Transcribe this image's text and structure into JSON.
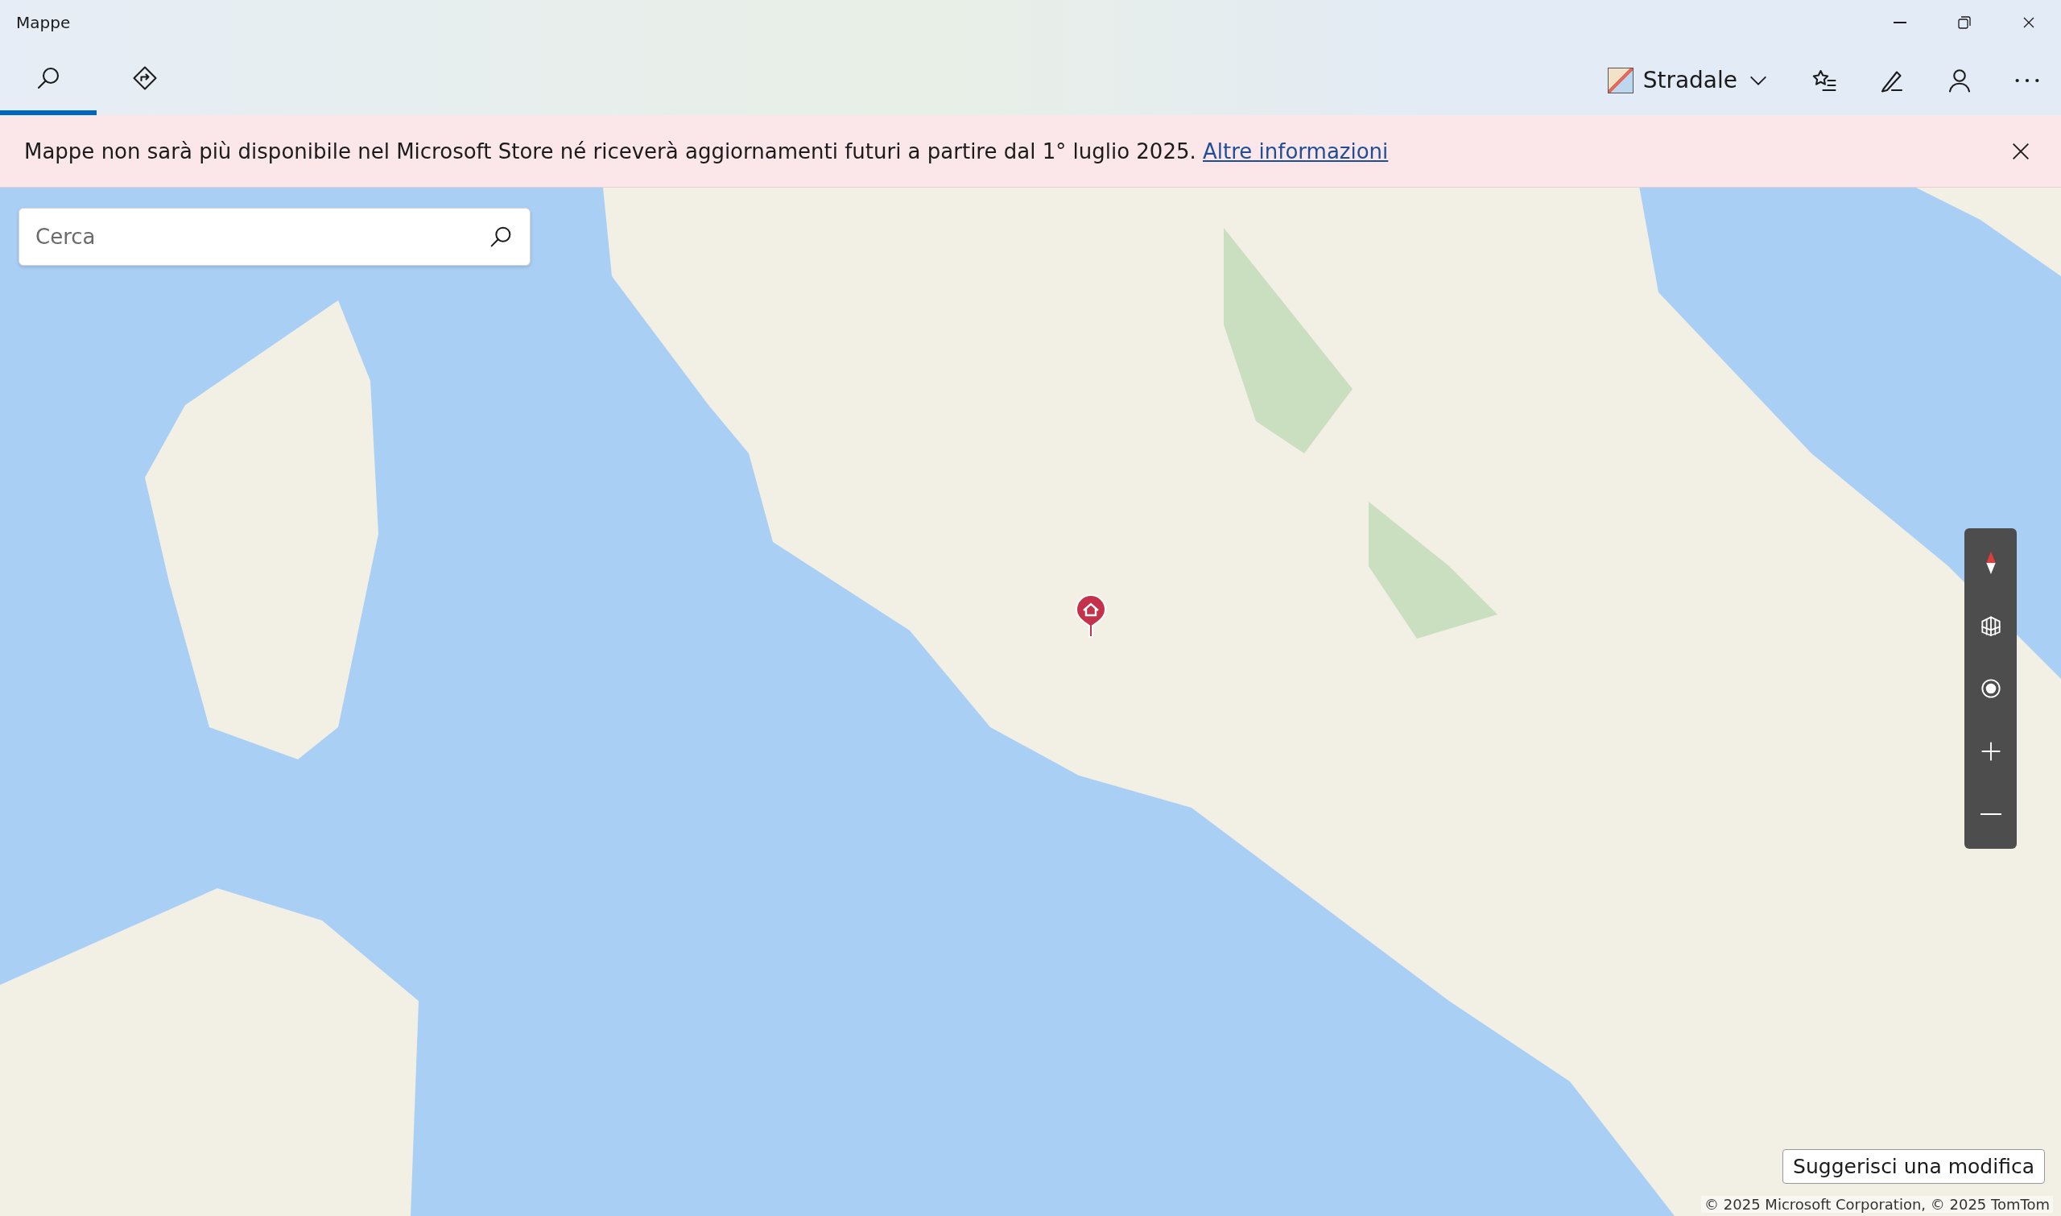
{
  "window": {
    "title": "Mappe"
  },
  "tabs": [
    {
      "kind": "search",
      "selected": true
    },
    {
      "kind": "directions",
      "selected": false
    }
  ],
  "map_style": {
    "label": "Stradale"
  },
  "toolbar": [
    {
      "kind": "favorites"
    },
    {
      "kind": "ink"
    },
    {
      "kind": "account"
    },
    {
      "kind": "more"
    }
  ],
  "banner": {
    "message": "Mappe non sarà più disponibile nel Microsoft Store né riceverà aggiornamenti futuri a partire dal 1° luglio 2025.",
    "link": "Altre informazioni"
  },
  "search": {
    "placeholder": "Cerca"
  },
  "map_controls": [
    {
      "kind": "compass"
    },
    {
      "kind": "cities"
    },
    {
      "kind": "locate"
    },
    {
      "kind": "zoom_in"
    },
    {
      "kind": "zoom_out"
    }
  ],
  "suggest_button": "Suggerisci una modifica",
  "copyright": "© 2025 Microsoft Corporation, © 2025 TomTom"
}
